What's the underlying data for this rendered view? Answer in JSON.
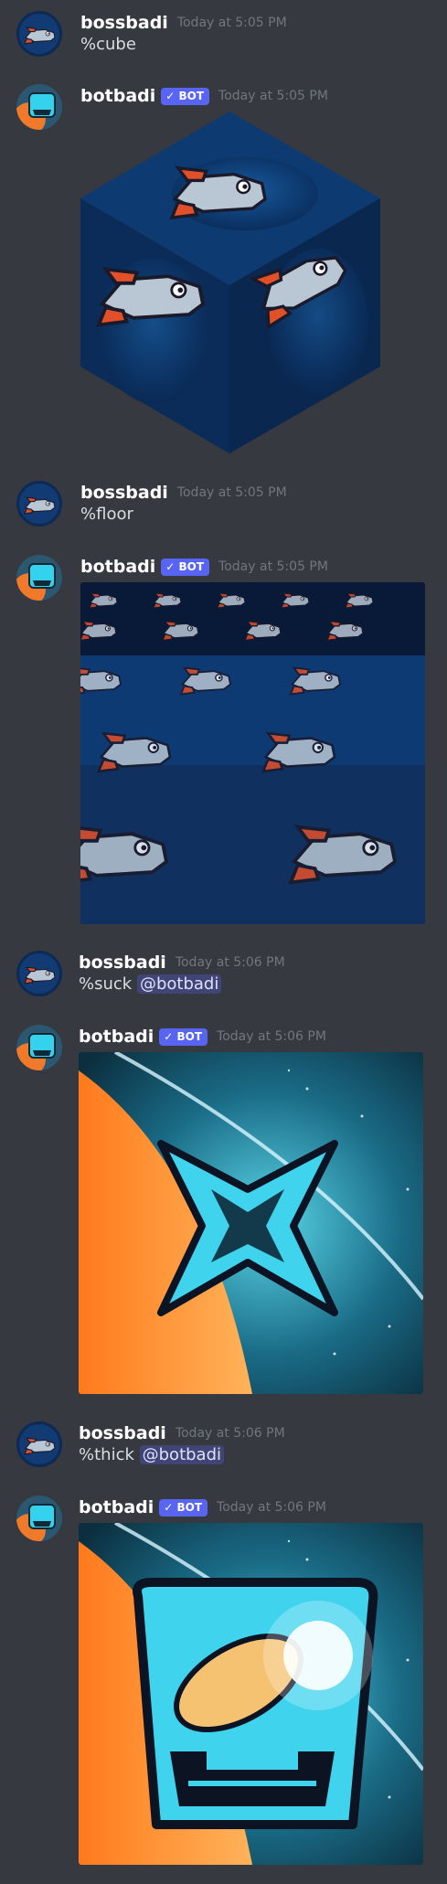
{
  "colors": {
    "background": "#36393f",
    "username": "#ffffff",
    "timestamp": "#72767d",
    "text": "#dcddde",
    "bot_tag": "#5865f2"
  },
  "messages": [
    {
      "author": "bossbadi",
      "timestamp": "Today at 5:05 PM",
      "text": "%cube",
      "mention": ""
    },
    {
      "author": "botbadi",
      "bot_tag": "✓ BOT",
      "timestamp": "Today at 5:05 PM",
      "attachment": "cube-image"
    },
    {
      "author": "bossbadi",
      "timestamp": "Today at 5:05 PM",
      "text": "%floor",
      "mention": ""
    },
    {
      "author": "botbadi",
      "bot_tag": "✓ BOT",
      "timestamp": "Today at 5:05 PM",
      "attachment": "floor-image"
    },
    {
      "author": "bossbadi",
      "timestamp": "Today at 5:06 PM",
      "text": "%suck",
      "mention": "@botbadi"
    },
    {
      "author": "botbadi",
      "bot_tag": "✓ BOT",
      "timestamp": "Today at 5:06 PM",
      "attachment": "suck-image"
    },
    {
      "author": "bossbadi",
      "timestamp": "Today at 5:06 PM",
      "text": "%thick",
      "mention": "@botbadi"
    },
    {
      "author": "botbadi",
      "bot_tag": "✓ BOT",
      "timestamp": "Today at 5:06 PM",
      "attachment": "thick-image"
    }
  ]
}
